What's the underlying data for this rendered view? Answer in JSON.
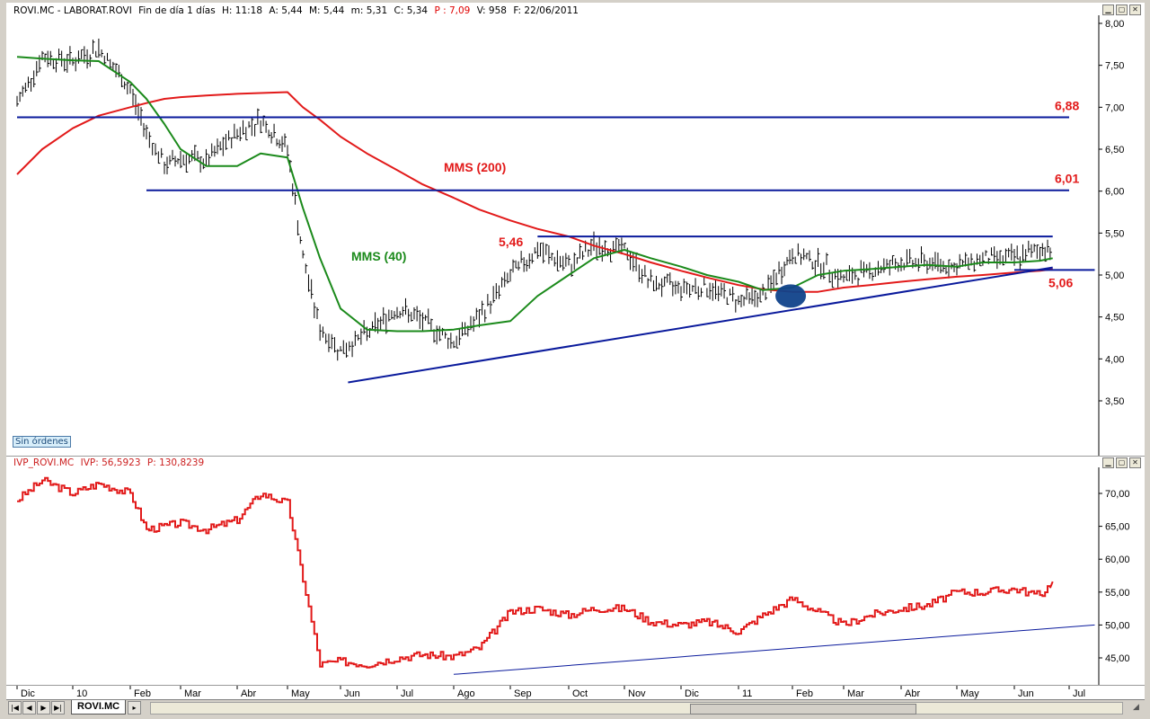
{
  "price_pane": {
    "header": {
      "symbol": "ROVI.MC - LABORAT.ROVI",
      "period": "Fin de día 1 días",
      "time": "H: 11:18",
      "open": "A: 5,44",
      "high": "M: 5,44",
      "low": "m: 5,31",
      "close": "C: 5,34",
      "pct": "P : 7,09",
      "volume": "V: 958",
      "date": "F: 22/06/2011"
    },
    "badge": "Sin órdenes"
  },
  "ivp_pane": {
    "header": {
      "name": "IVP_ROVI.MC",
      "ivp": "IVP: 56,5923",
      "p": "P: 130,8239"
    }
  },
  "window_buttons": [
    "minimize",
    "maximize",
    "close"
  ],
  "nav": {
    "buttons": [
      "first",
      "prev",
      "next",
      "last"
    ],
    "tab_label": "ROVI.MC"
  },
  "colors": {
    "price_bars": "#000000",
    "mms200": "#e21a1a",
    "mms40": "#1b8a1b",
    "support_resistance": "#0a1a9c",
    "ivp_line": "#e21a1a",
    "ivp_trend": "#0a1a9c",
    "marker": "#10428a"
  },
  "chart_data": [
    {
      "type": "line",
      "subtype": "ohlc-bars",
      "title": "",
      "xlabel": "",
      "ylabel": "",
      "x_ticks": [
        "Dic",
        "10",
        "Feb",
        "Mar",
        "Abr",
        "May",
        "Jun",
        "Jul",
        "Ago",
        "Sep",
        "Oct",
        "Nov",
        "Dic",
        "11",
        "Feb",
        "Mar",
        "Abr",
        "May",
        "Jun",
        "Jul"
      ],
      "y_ticks": [
        "8,00",
        "7,50",
        "7,00",
        "6,50",
        "6,00",
        "5,50",
        "5,00",
        "4,50",
        "4,00",
        "3,50"
      ],
      "ylim": [
        3.5,
        8.0
      ],
      "y_axis_position": "right",
      "grid": false,
      "x": [
        "2009-12-01",
        "2009-12-15",
        "2010-01-01",
        "2010-01-15",
        "2010-02-01",
        "2010-02-10",
        "2010-02-20",
        "2010-03-01",
        "2010-03-15",
        "2010-04-01",
        "2010-04-15",
        "2010-05-01",
        "2010-05-10",
        "2010-05-20",
        "2010-06-01",
        "2010-06-15",
        "2010-07-01",
        "2010-07-15",
        "2010-08-01",
        "2010-08-15",
        "2010-09-01",
        "2010-09-15",
        "2010-10-01",
        "2010-10-15",
        "2010-11-01",
        "2010-11-15",
        "2010-12-01",
        "2010-12-15",
        "2011-01-01",
        "2011-01-15",
        "2011-02-01",
        "2011-02-15",
        "2011-03-01",
        "2011-03-15",
        "2011-04-01",
        "2011-04-15",
        "2011-05-01",
        "2011-05-15",
        "2011-06-01",
        "2011-06-15",
        "2011-06-22"
      ],
      "series": [
        {
          "type": "ohlc",
          "close": [
            7.05,
            7.6,
            7.55,
            7.7,
            7.2,
            6.7,
            6.3,
            6.4,
            6.35,
            6.7,
            6.85,
            6.5,
            5.2,
            4.35,
            4.1,
            4.3,
            4.6,
            4.45,
            4.2,
            4.5,
            5.0,
            5.3,
            5.1,
            5.35,
            5.3,
            4.9,
            4.85,
            4.85,
            4.7,
            4.75,
            5.25,
            5.15,
            4.95,
            5.05,
            5.15,
            5.15,
            5.1,
            5.2,
            5.2,
            5.3,
            5.34
          ]
        },
        {
          "name": "MMS (200)",
          "values": [
            6.2,
            6.5,
            6.75,
            6.9,
            7.0,
            7.05,
            7.1,
            7.12,
            7.14,
            7.16,
            7.17,
            7.18,
            7.0,
            6.85,
            6.65,
            6.45,
            6.25,
            6.08,
            5.92,
            5.78,
            5.65,
            5.55,
            5.46,
            5.35,
            5.25,
            5.15,
            5.05,
            4.97,
            4.88,
            4.83,
            4.8,
            4.8,
            4.85,
            4.88,
            4.92,
            4.95,
            4.98,
            5.0,
            5.03,
            5.05,
            5.07
          ]
        },
        {
          "name": "MMS (40)",
          "values": [
            7.6,
            7.58,
            7.56,
            7.55,
            7.3,
            7.1,
            6.8,
            6.5,
            6.3,
            6.3,
            6.45,
            6.4,
            5.8,
            5.2,
            4.6,
            4.35,
            4.33,
            4.33,
            4.35,
            4.4,
            4.45,
            4.75,
            5.0,
            5.2,
            5.3,
            5.2,
            5.1,
            5.0,
            4.92,
            4.82,
            4.85,
            5.0,
            5.05,
            5.07,
            5.1,
            5.12,
            5.1,
            5.15,
            5.15,
            5.17,
            5.2
          ]
        }
      ],
      "horizontal_lines": [
        {
          "value": 6.88,
          "label": "6,88"
        },
        {
          "value": 6.01,
          "label": "6,01"
        },
        {
          "value": 5.46,
          "label": "5,46"
        },
        {
          "value": 5.06,
          "label": "5,06"
        }
      ],
      "trendline": {
        "from": [
          "2010-06-05",
          3.72
        ],
        "to": [
          "2011-06-22",
          5.09
        ]
      },
      "annotations": [
        "MMS (200)",
        "MMS (40)",
        "5,46",
        "6,88",
        "6,01",
        "5,06"
      ],
      "marker": {
        "x": "2011-01-31",
        "y": 4.75
      }
    },
    {
      "type": "line",
      "title": "",
      "xlabel": "",
      "ylabel": "",
      "y_ticks": [
        "70,00",
        "65,00",
        "60,00",
        "55,00",
        "50,00",
        "45,00"
      ],
      "ylim": [
        41.5,
        73
      ],
      "y_axis_position": "right",
      "grid": false,
      "x": [
        "2009-12-01",
        "2009-12-15",
        "2010-01-01",
        "2010-01-15",
        "2010-02-01",
        "2010-02-10",
        "2010-02-20",
        "2010-03-01",
        "2010-03-15",
        "2010-04-01",
        "2010-04-15",
        "2010-05-01",
        "2010-05-10",
        "2010-05-20",
        "2010-06-01",
        "2010-06-15",
        "2010-07-01",
        "2010-07-15",
        "2010-08-01",
        "2010-08-15",
        "2010-09-01",
        "2010-09-15",
        "2010-10-01",
        "2010-10-15",
        "2010-11-01",
        "2010-11-15",
        "2010-12-01",
        "2010-12-15",
        "2011-01-01",
        "2011-01-15",
        "2011-02-01",
        "2011-02-15",
        "2011-03-01",
        "2011-03-15",
        "2011-04-01",
        "2011-04-15",
        "2011-05-01",
        "2011-05-15",
        "2011-06-01",
        "2011-06-15",
        "2011-06-22"
      ],
      "series": [
        {
          "name": "IVP_ROVI.MC",
          "values": [
            69,
            72,
            70,
            71.5,
            70,
            64.5,
            65,
            65.5,
            64.5,
            66,
            70,
            68.5,
            57,
            44,
            44.5,
            44,
            45,
            45.5,
            45.2,
            46.5,
            52,
            52.5,
            51.5,
            52.5,
            52.5,
            50.5,
            50,
            50.5,
            49,
            51.5,
            54,
            52,
            50,
            51.5,
            52.5,
            53,
            55,
            55,
            55.5,
            54.5,
            56.6
          ]
        }
      ],
      "trendline": {
        "from": [
          "2010-08-01",
          42.5
        ],
        "to": [
          "2011-07-15",
          50.0
        ]
      }
    }
  ]
}
